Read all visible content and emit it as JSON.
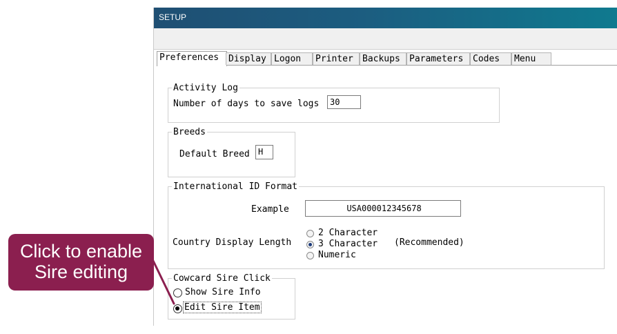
{
  "window": {
    "title": "SETUP"
  },
  "tabs": [
    {
      "label": "Preferences"
    },
    {
      "label": "Display"
    },
    {
      "label": "Logon"
    },
    {
      "label": "Printer"
    },
    {
      "label": "Backups"
    },
    {
      "label": "Parameters"
    },
    {
      "label": "Codes"
    },
    {
      "label": "Menu"
    }
  ],
  "activity_log": {
    "legend": "Activity Log",
    "days_label": "Number of days to save logs",
    "days_value": "30"
  },
  "breeds": {
    "legend": "Breeds",
    "default_label": "Default Breed",
    "default_value": "H"
  },
  "intl_id": {
    "legend": "International ID Format",
    "example_label": "Example",
    "example_value": "USA000012345678",
    "country_label": "Country Display Length",
    "options": [
      "2 Character",
      "3 Character",
      "Numeric"
    ],
    "selected": "3 Character",
    "recommended": "(Recommended)"
  },
  "cowcard": {
    "legend": "Cowcard Sire Click",
    "options": [
      "Show Sire Info",
      "Edit Sire Item"
    ],
    "selected": "Edit Sire Item"
  },
  "callout": {
    "line1": "Click to enable",
    "line2": "Sire editing"
  },
  "colors": {
    "callout_bg": "#8b1f4f",
    "titlebar": "#1f4f73"
  }
}
